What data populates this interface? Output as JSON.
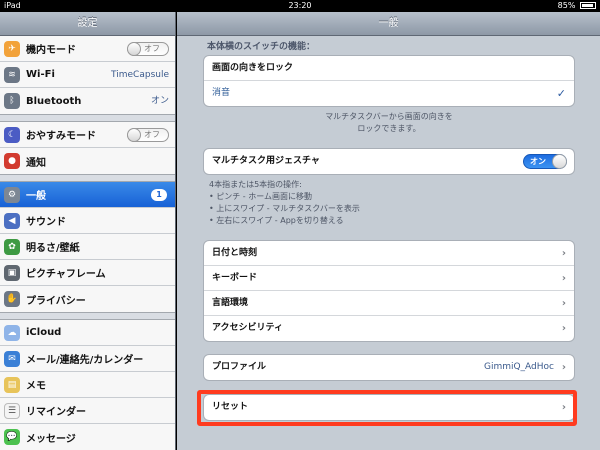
{
  "status": {
    "device": "iPad",
    "time": "23:20",
    "battery": "85%"
  },
  "sidebar": {
    "title": "設定",
    "groups": [
      [
        {
          "label": "機内モード",
          "toggle": "オフ",
          "icon": "airplane-icon",
          "color": "#f2a23a"
        },
        {
          "label": "Wi-Fi",
          "value": "TimeCapsule",
          "icon": "wifi-icon",
          "color": "#6c7786"
        },
        {
          "label": "Bluetooth",
          "value": "オン",
          "icon": "bluetooth-icon",
          "color": "#6c7786"
        }
      ],
      [
        {
          "label": "おやすみモード",
          "toggle": "オフ",
          "icon": "moon-icon",
          "color": "#4b5cc4"
        },
        {
          "label": "通知",
          "icon": "notification-icon",
          "color": "#d23b2f"
        }
      ],
      [
        {
          "label": "一般",
          "badge": "1",
          "icon": "gear-icon",
          "color": "#7d8794",
          "active": true
        },
        {
          "label": "サウンド",
          "icon": "sound-icon",
          "color": "#4b6fc2"
        },
        {
          "label": "明るさ/壁紙",
          "icon": "flower-icon",
          "color": "#3e9a43"
        },
        {
          "label": "ピクチャフレーム",
          "icon": "picture-frame-icon",
          "color": "#5f6770"
        },
        {
          "label": "プライバシー",
          "icon": "hand-icon",
          "color": "#6c7786"
        }
      ],
      [
        {
          "label": "iCloud",
          "icon": "cloud-icon",
          "color": "#8fb4e8"
        },
        {
          "label": "メール/連絡先/カレンダー",
          "icon": "mail-icon",
          "color": "#3b80d6"
        },
        {
          "label": "メモ",
          "icon": "notes-icon",
          "color": "#e8c45a"
        },
        {
          "label": "リマインダー",
          "icon": "reminders-icon",
          "color": "#f4f4f4"
        },
        {
          "label": "メッセージ",
          "icon": "messages-icon",
          "color": "#4cc14f"
        }
      ]
    ]
  },
  "main": {
    "title": "一般",
    "side_switch_title": "本体横のスイッチの機能：",
    "side_switch_options": [
      {
        "label": "画面の向きをロック"
      },
      {
        "label": "消音",
        "checked": "✓"
      }
    ],
    "side_switch_note_1": "マルチタスクバーから画面の向きを",
    "side_switch_note_2": "ロックできます。",
    "multitask_label": "マルチタスク用ジェスチャ",
    "multitask_toggle": "オン",
    "gesture_note": [
      "4本指または5本指の操作:",
      "• ピンチ - ホーム画面に移動",
      "• 上にスワイプ - マルチタスクバーを表示",
      "• 左右にスワイプ - Appを切り替える"
    ],
    "rows": [
      {
        "label": "日付と時刻"
      },
      {
        "label": "キーボード"
      },
      {
        "label": "言語環境"
      },
      {
        "label": "アクセシビリティ"
      }
    ],
    "profile": {
      "label": "プロファイル",
      "value": "GimmiQ_AdHoc"
    },
    "reset": {
      "label": "リセット"
    },
    "chevron": "›",
    "highlight_color": "#ff3b1f"
  }
}
